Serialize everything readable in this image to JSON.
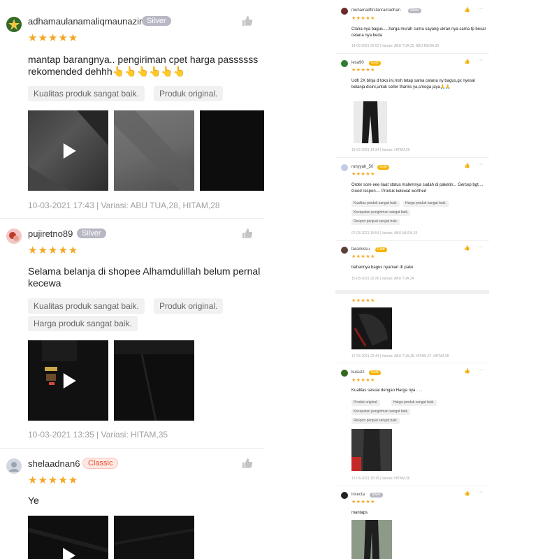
{
  "left_reviews": [
    {
      "username": "adhamaulanamaliqmaunazir",
      "badge": "Silver",
      "stars": "★★★★★",
      "text_line1": "mantap barangnya.. pengiriman cpet harga passssss",
      "text_line2": "rekomended dehhh👆👆👆👆👆👆",
      "tags": [
        "Kualitas produk sangat baik.",
        "Produk original."
      ],
      "meta": "10-03-2021 17:43 | Variasi: ABU TUA,28, HITAM,28"
    },
    {
      "username": "pujiretno89",
      "badge": "Silver",
      "stars": "★★★★★",
      "text_line1": "Selama belanja di shopee Alhamdulillah belum pernal",
      "text_line2": "kecewa",
      "tags": [
        "Kualitas produk sangat baik.",
        "Produk original.",
        "Harga produk sangat baik."
      ],
      "meta": "10-03-2021 13:35 | Variasi: HITAM,35"
    },
    {
      "username": "shelaadnan6",
      "badge": "Classic",
      "stars": "★★★★★",
      "text_line1": "Ye"
    }
  ],
  "right_reviews": [
    {
      "username": "muhamadfirstanramadhan",
      "badge": "Silver",
      "stars": "★★★★★",
      "text": "Clana nya bagus.....harga murah cuma sayang ukran nya sama tp besar celana nya beda",
      "meta": "14-03-2021 22:02 | Variasi: ABU TUA,29, ABU MUDA,29"
    },
    {
      "username": "lesa90",
      "badge": "Gold",
      "stars": "★★★★★",
      "text": "Udh 2X blnja d toko ini,msh tetap sama celana ny bagus,gx nyesal belanja disini,untuk seller thanks ya,smoga jaya🙏🙏",
      "meta": "19-03-2021 14:34 | Variasi: HITAM,29"
    },
    {
      "username": "ronyyah_50",
      "badge": "Gold",
      "stars": "★★★★★",
      "text": "Order sore eee liaat status malemnya sudah di paketin... Gercep bgt.... Good respon.... Produk kelewat worthed",
      "tags": [
        "Kualitas produk sangat baik.",
        "Harga produk sangat baik.",
        "Kecepatan pengiriman sangat baik.",
        "Respon penjual sangat baik."
      ],
      "meta": "07-03-2021 19:54 | Variasi: ABU MUDA,33"
    },
    {
      "username": "taramissu",
      "badge": "Gold",
      "stars": "★★★★★",
      "text": "bahannya bagus nyaman di pake",
      "meta": "15-03-2021 22:20 | Variasi: ABU TUA,34"
    },
    {
      "stars": "★★★★★",
      "meta": "17-03-2021 22:44 | Variasi: ABU TUA,28, HITAM,27, HITAM,28"
    },
    {
      "username": "kusuzz",
      "badge": "Gold",
      "stars": "★★★★★",
      "text": "Kualitas sesuai dengan Harga nya . . .",
      "tags": [
        "Produk original.",
        "Harga produk sangat baik.",
        "Kecepatan pengiriman sangat baik.",
        "Respon penjual sangat baik."
      ],
      "meta": "12-03-2021 10:15 | Variasi: HITAM,36"
    },
    {
      "username": "incecta",
      "badge": "Silver",
      "stars": "★★★★★",
      "text": "mantaps"
    }
  ],
  "icons": {
    "like": "thumbs-up-icon",
    "more": "more-dots-icon",
    "play": "play-icon"
  },
  "colors": {
    "star": "#f5a623",
    "silver_badge": "#b8b8c4",
    "gold_badge": "#f4b400",
    "classic_badge": "#ee4d2d"
  }
}
